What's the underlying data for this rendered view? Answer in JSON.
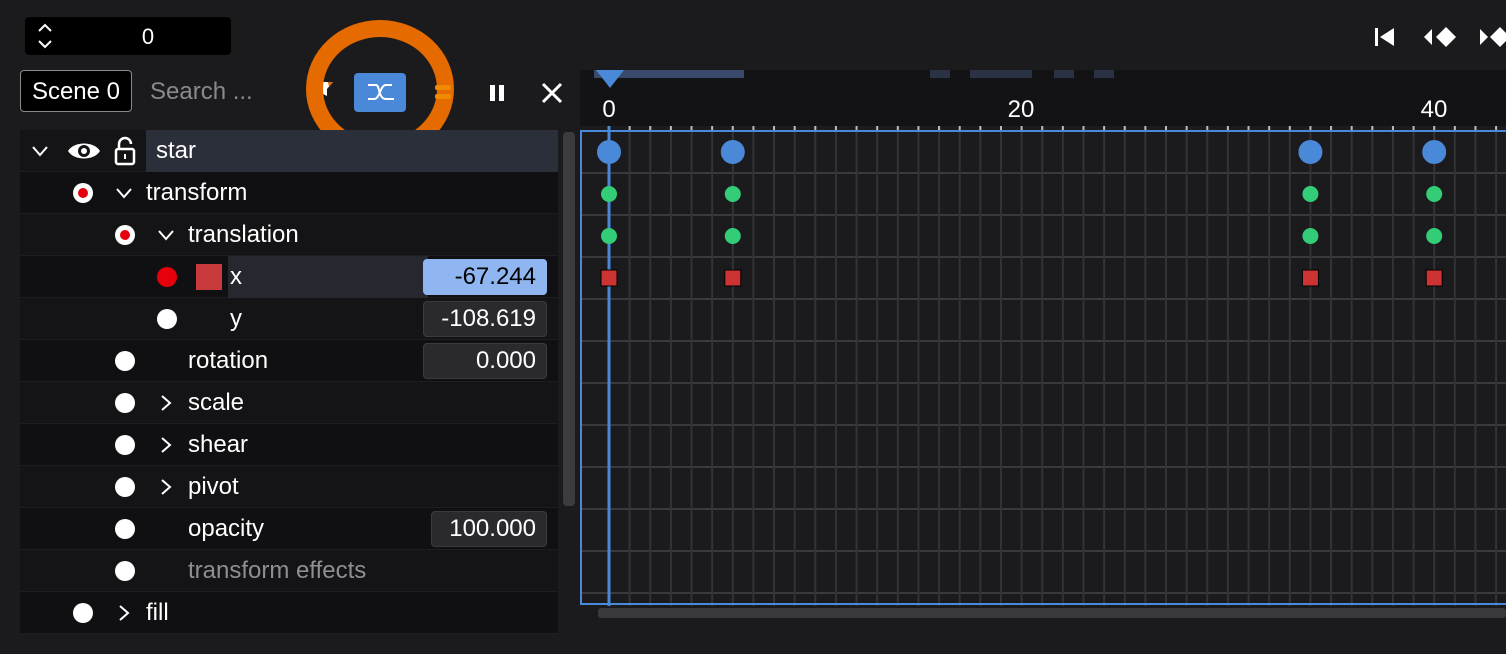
{
  "frame": {
    "value": "0"
  },
  "transport": {
    "icons": [
      "go-to-start-icon",
      "previous-keyframe-icon",
      "next-keyframe-icon"
    ]
  },
  "panel": {
    "scene_label": "Scene 0",
    "search_placeholder": "Search ...",
    "buttons": [
      "filter-icon",
      "curve-editor-icon",
      "pause-icon",
      "close-icon"
    ]
  },
  "tree": {
    "star": {
      "label": "star"
    },
    "transform": {
      "label": "transform"
    },
    "translation": {
      "label": "translation"
    },
    "x": {
      "label": "x",
      "value": "-67.244"
    },
    "y": {
      "label": "y",
      "value": "-108.619"
    },
    "rotation": {
      "label": "rotation",
      "value": "0.000"
    },
    "scale": {
      "label": "scale"
    },
    "shear": {
      "label": "shear"
    },
    "pivot": {
      "label": "pivot"
    },
    "opacity": {
      "label": "opacity",
      "value": "100.000"
    },
    "transform_effects": {
      "label": "transform effects"
    },
    "fill": {
      "label": "fill"
    }
  },
  "timeline": {
    "tick_labels": [
      "0",
      "20",
      "40"
    ],
    "keyframes": [
      0,
      6,
      34,
      40
    ],
    "colors": {
      "accent": "#4a88d8",
      "green": "#33cc77",
      "red": "#cc3333",
      "highlight": "#e56a00"
    }
  }
}
